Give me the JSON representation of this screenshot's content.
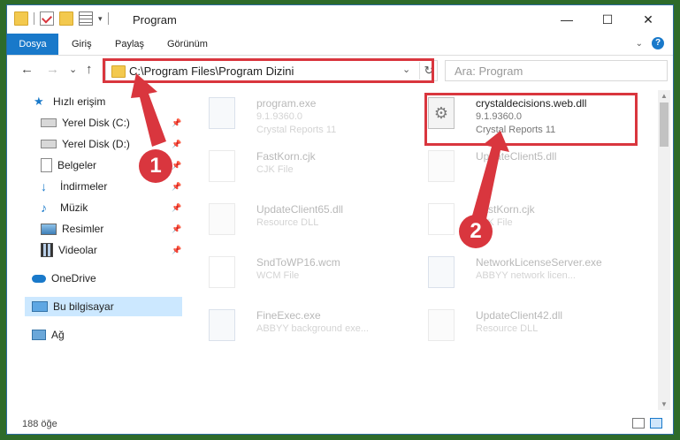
{
  "window": {
    "title": "Program",
    "controls": {
      "minimize": "—",
      "maximize": "☐",
      "close": "✕"
    }
  },
  "ribbon": {
    "tabs": [
      "Dosya",
      "Giriş",
      "Paylaş",
      "Görünüm"
    ],
    "help": "?"
  },
  "navigation": {
    "back": "←",
    "forward": "→",
    "recent": "⌄",
    "up": "↑",
    "address": "C:\\Program Files\\Program Dizini",
    "refresh": "↻",
    "search_placeholder": "Ara: Program"
  },
  "sidebar": {
    "items": [
      {
        "label": "Hızlı erişim",
        "icon": "star-icon"
      },
      {
        "label": "Yerel Disk (C:)",
        "icon": "drive-icon",
        "pinned": true
      },
      {
        "label": "Yerel Disk (D:)",
        "icon": "drive-icon",
        "pinned": true
      },
      {
        "label": "Belgeler",
        "icon": "documents-icon",
        "pinned": true
      },
      {
        "label": "İndirmeler",
        "icon": "download-icon",
        "pinned": true
      },
      {
        "label": "Müzik",
        "icon": "music-icon",
        "pinned": true
      },
      {
        "label": "Resimler",
        "icon": "pictures-icon",
        "pinned": true
      },
      {
        "label": "Videolar",
        "icon": "videos-icon",
        "pinned": true
      },
      {
        "label": "OneDrive",
        "icon": "cloud-icon"
      },
      {
        "label": "Bu bilgisayar",
        "icon": "computer-icon",
        "selected": true
      },
      {
        "label": "Ağ",
        "icon": "network-icon"
      }
    ]
  },
  "files": [
    {
      "name": "program.exe",
      "line1": "9.1.9360.0",
      "line2": "Crystal Reports 11",
      "icon": "installer-icon"
    },
    {
      "name": "crystaldecisions.web.dll",
      "line1": "9.1.9360.0",
      "line2": "Crystal Reports 11",
      "icon": "dll-gear-icon",
      "highlighted": true
    },
    {
      "name": "FastKorn.cjk",
      "line1": "CJK File",
      "line2": "",
      "icon": "blank-file-icon"
    },
    {
      "name": "UpdateClient5.dll",
      "line1": "",
      "line2": "",
      "icon": "dll-gear-icon"
    },
    {
      "name": "UpdateClient65.dll",
      "line1": "Resource DLL",
      "line2": "",
      "icon": "dll-gear-icon"
    },
    {
      "name": "FastKorn.cjk",
      "line1": "CJK File",
      "line2": "",
      "icon": "blank-file-icon"
    },
    {
      "name": "SndToWP16.wcm",
      "line1": "WCM File",
      "line2": "",
      "icon": "blank-file-icon"
    },
    {
      "name": "NetworkLicenseServer.exe",
      "line1": "ABBYY network licen...",
      "line2": "",
      "icon": "app-window-icon"
    },
    {
      "name": "FineExec.exe",
      "line1": "ABBYY background exe...",
      "line2": "",
      "icon": "app-window-icon"
    },
    {
      "name": "UpdateClient42.dll",
      "line1": "Resource DLL",
      "line2": "",
      "icon": "dll-gear-icon"
    }
  ],
  "status": {
    "item_count": "188 öğe"
  },
  "annotations": {
    "step1": "1",
    "step2": "2",
    "color": "#d9363e"
  }
}
